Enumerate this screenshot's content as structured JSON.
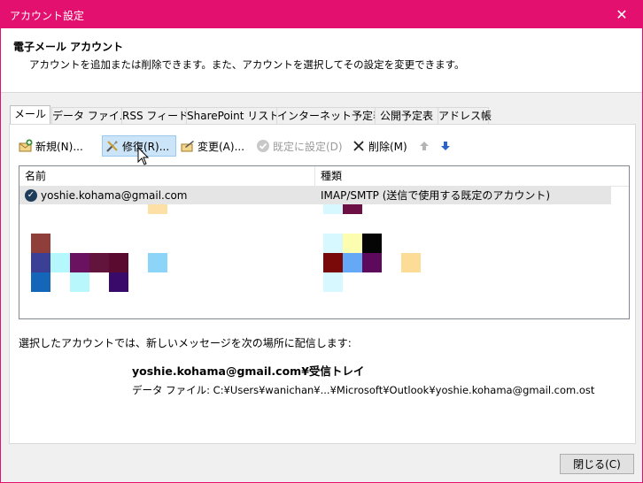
{
  "window": {
    "title": "アカウント設定",
    "close_glyph": "✕",
    "accent_color": "#e3106f"
  },
  "header": {
    "title": "電子メール アカウント",
    "description": "アカウントを追加または削除できます。また、アカウントを選択してその設定を変更できます。"
  },
  "tabs": [
    {
      "label": "メール",
      "active": true
    },
    {
      "label": "データ ファイル"
    },
    {
      "label": "RSS フィード"
    },
    {
      "label": "SharePoint リスト"
    },
    {
      "label": "インターネット予定表"
    },
    {
      "label": "公開予定表"
    },
    {
      "label": "アドレス帳"
    }
  ],
  "toolbar": {
    "new_label": "新規(N)...",
    "repair_label": "修復(R)...",
    "change_label": "変更(A)...",
    "set_default_label": "既定に設定(D)",
    "delete_label": "削除(M)",
    "icons": [
      "new-account-icon",
      "repair-icon",
      "change-icon",
      "set-default-icon",
      "delete-icon",
      "move-up-icon",
      "move-down-icon"
    ]
  },
  "list": {
    "columns": [
      "名前",
      "種類"
    ],
    "rows": [
      {
        "name": "yoshie.kohama@gmail.com",
        "type": "IMAP/SMTP (送信で使用する既定のアカウント)",
        "selected": true
      }
    ]
  },
  "delivery": {
    "label": "選択したアカウントでは、新しいメッセージを次の場所に配信します:",
    "folder": "yoshie.kohama@gmail.com¥受信トレイ",
    "data_file": "データ ファイル: C:¥Users¥wanichan¥...¥Microsoft¥Outlook¥yoshie.kohama@gmail.com.ost"
  },
  "footer": {
    "close_label": "閉じる(C)"
  }
}
